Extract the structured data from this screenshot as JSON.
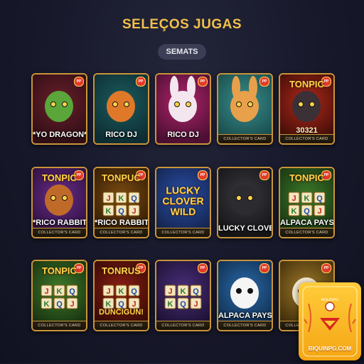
{
  "page": {
    "title": "SELEÇOS JUGAS",
    "filter_pill": "SEMATS"
  },
  "cards": [
    {
      "label": "*YO DRAGON*",
      "footer": "",
      "theme": "dragon-green"
    },
    {
      "label": "RICO DJ",
      "footer": "",
      "theme": "dragon-orange"
    },
    {
      "label": "RICO DJ",
      "footer": "",
      "theme": "rabbit-white"
    },
    {
      "label": "",
      "footer": "COLLECTOR'S CARD",
      "theme": "rabbit-orange"
    },
    {
      "label": "",
      "footer": "COLLECTOR'S CARD",
      "theme": "gorilla-red",
      "banner": "TONPIC",
      "number": "30321"
    },
    {
      "label": "*RICO RABBIT",
      "footer": "COLLECTOR'S CARD",
      "theme": "monkey-purple",
      "banner": "TONPIC"
    },
    {
      "label": "*RICO RABBIT",
      "footer": "COLLECTOR'S CARD",
      "theme": "slots-gold",
      "banner": "TONPUC"
    },
    {
      "label": "",
      "footer": "COLLECTOR'S CARD",
      "theme": "lucky-clover",
      "big": "LUCKY CLOVER WILD"
    },
    {
      "label": "LUCKY CLOVER",
      "footer": "",
      "theme": "gorilla-dark"
    },
    {
      "label": "ALPACA PAYS",
      "footer": "COLLECTOR'S CARD",
      "theme": "alpaca-green",
      "banner": "TONPIC"
    },
    {
      "label": "",
      "footer": "COLLECTOR'S CARD",
      "theme": "slots-jungle",
      "banner": "TONPIC"
    },
    {
      "label": "",
      "footer": "COLLECTOR'S CARD",
      "theme": "slots-red",
      "banner": "TONRUS",
      "big": "DUNCIGUN!"
    },
    {
      "label": "",
      "footer": "COLLECTOR'S CARD",
      "theme": "slots-purple"
    },
    {
      "label": "ALPACA PAYS",
      "footer": "COLLECTOR'S CARD",
      "theme": "panda-blue"
    },
    {
      "label": "",
      "footer": "COLLECTOR'S CARD",
      "theme": "alpaca-gold"
    }
  ],
  "promo": {
    "site": "BIQUINPG.COM",
    "small_text": "MQUINPG"
  },
  "colors": {
    "title": "#f2c04a",
    "card_border": "#c9953a",
    "background": "#17182a"
  }
}
